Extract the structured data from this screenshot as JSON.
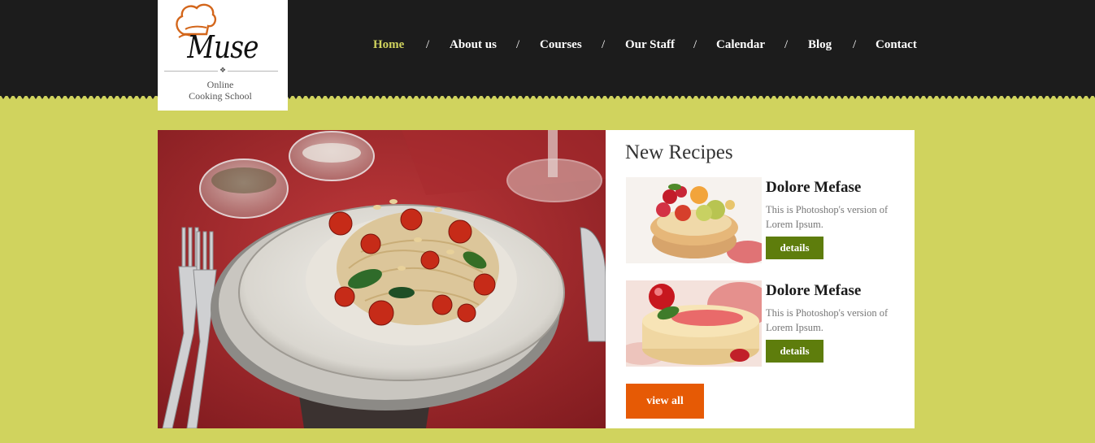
{
  "logo": {
    "brand": "Muse",
    "subtitle_line1": "Online",
    "subtitle_line2": "Cooking School",
    "ornament": "❖"
  },
  "nav": {
    "separator": "/",
    "items": [
      {
        "label": "Home",
        "active": true
      },
      {
        "label": "About us",
        "active": false
      },
      {
        "label": "Courses",
        "active": false
      },
      {
        "label": "Our Staff",
        "active": false
      },
      {
        "label": "Calendar",
        "active": false
      },
      {
        "label": "Blog",
        "active": false
      },
      {
        "label": "Contact",
        "active": false
      }
    ]
  },
  "recipes": {
    "heading": "New Recipes",
    "items": [
      {
        "title": "Dolore Mefase",
        "description": "This is Photoshop's version of Lorem Ipsum.",
        "button": "details"
      },
      {
        "title": "Dolore Mefase",
        "description": "This is Photoshop's version of Lorem Ipsum.",
        "button": "details"
      }
    ],
    "view_all": "view all"
  },
  "colors": {
    "background": "#d0d35e",
    "header": "#1c1c1c",
    "nav_active": "#d0d35e",
    "details_button": "#5e7d0c",
    "view_all_button": "#e65a05"
  },
  "icons": {
    "logo_mark": "chef-hat-icon"
  }
}
